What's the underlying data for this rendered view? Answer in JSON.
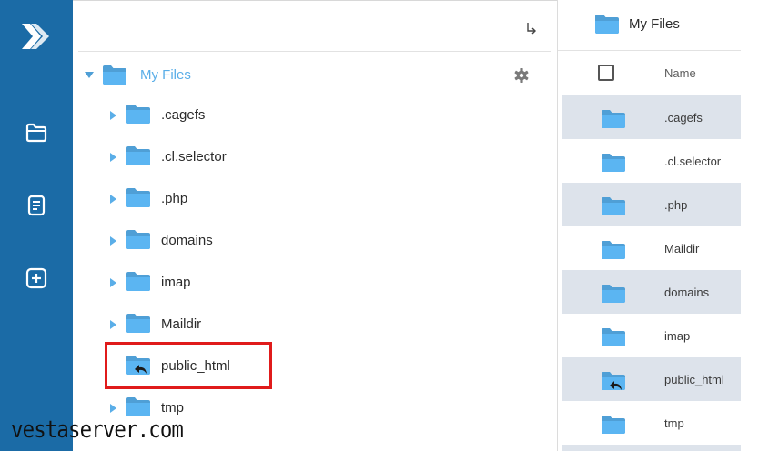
{
  "tree": {
    "root_label": "My Files",
    "items": [
      {
        "label": ".cagefs",
        "expandable": true
      },
      {
        "label": ".cl.selector",
        "expandable": true
      },
      {
        "label": ".php",
        "expandable": true
      },
      {
        "label": "domains",
        "expandable": true
      },
      {
        "label": "imap",
        "expandable": true
      },
      {
        "label": "Maildir",
        "expandable": true
      },
      {
        "label": "public_html",
        "expandable": false,
        "symlink": true
      },
      {
        "label": "tmp",
        "expandable": true
      }
    ]
  },
  "list": {
    "breadcrumb": "My Files",
    "column_name": "Name",
    "rows": [
      {
        "name": ".cagefs"
      },
      {
        "name": ".cl.selector"
      },
      {
        "name": ".php"
      },
      {
        "name": "Maildir"
      },
      {
        "name": "domains"
      },
      {
        "name": "imap"
      },
      {
        "name": "public_html",
        "symlink": true
      },
      {
        "name": "tmp"
      }
    ]
  },
  "watermark": "vestaserver.com",
  "colors": {
    "rail": "#1b6ba6",
    "folder": "#5bb5f2",
    "accent_text": "#5aaee8",
    "row_shade": "#dde3eb",
    "highlight_border": "#e01b1b"
  },
  "icons": {
    "rail_logo": "double-chevron-logo",
    "nav": [
      "folder-icon",
      "document-icon",
      "add-icon"
    ],
    "tree_action": "collapse-arrow-icon",
    "settings": "gear-icon",
    "symlink": "link-arrow-icon"
  }
}
